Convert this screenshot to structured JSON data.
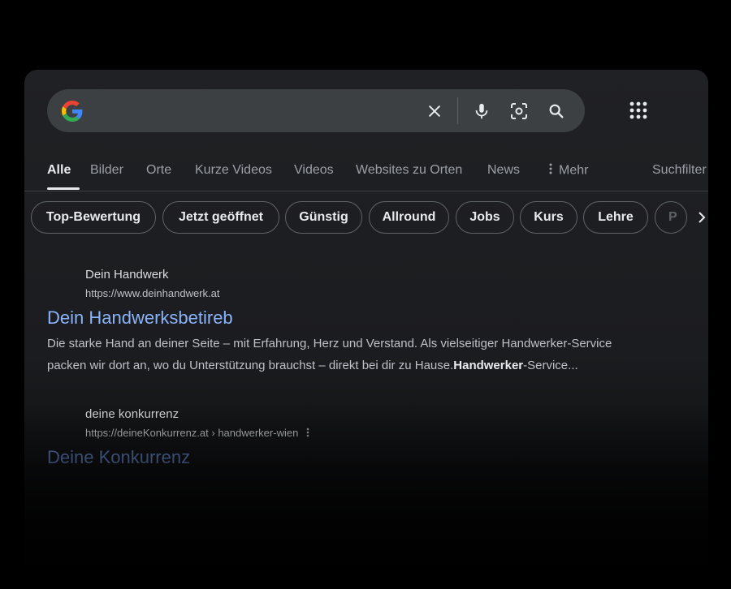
{
  "search": {
    "query": "",
    "clear_icon": "close-icon",
    "voice_icon": "microphone-icon",
    "lens_icon": "camera-lens-icon",
    "search_icon": "search-icon"
  },
  "apps_icon": "grid-apps-icon",
  "tabs": [
    {
      "label": "Alle",
      "active": true
    },
    {
      "label": "Bilder"
    },
    {
      "label": "Orte"
    },
    {
      "label": "Kurze Videos"
    },
    {
      "label": "Videos"
    },
    {
      "label": "Websites zu Orten"
    },
    {
      "label": "News"
    },
    {
      "label": "Mehr"
    },
    {
      "label": "Suchfilter"
    }
  ],
  "chips": [
    "Top-Bewertung",
    "Jetzt geöffnet",
    "Günstig",
    "Allround",
    "Jobs",
    "Kurs",
    "Lehre",
    "P"
  ],
  "results": [
    {
      "site_name": "Dein Handwerk",
      "url": "https://www.deinhandwerk.at",
      "title": "Dein Handwerksbetireb",
      "snippet_1": "Die starke Hand an deiner Seite – mit Erfahrung, Herz und Verstand. Als vielseitiger Handwerker-Service",
      "snippet_2_a": "packen wir dort an, wo du Unterstützung brauchst – direkt bei dir zu Hause.",
      "snippet_2_bold": "Handwerker",
      "snippet_2_b": "-Service..."
    },
    {
      "site_name": "deine konkurrenz",
      "url": "https://deineKonkurrenz.at › handwerker-wien",
      "title": "Deine Konkurrenz"
    }
  ],
  "colors": {
    "accent_link": "#8ab4f8",
    "surface": "#202124",
    "searchbar": "#3c4043"
  }
}
